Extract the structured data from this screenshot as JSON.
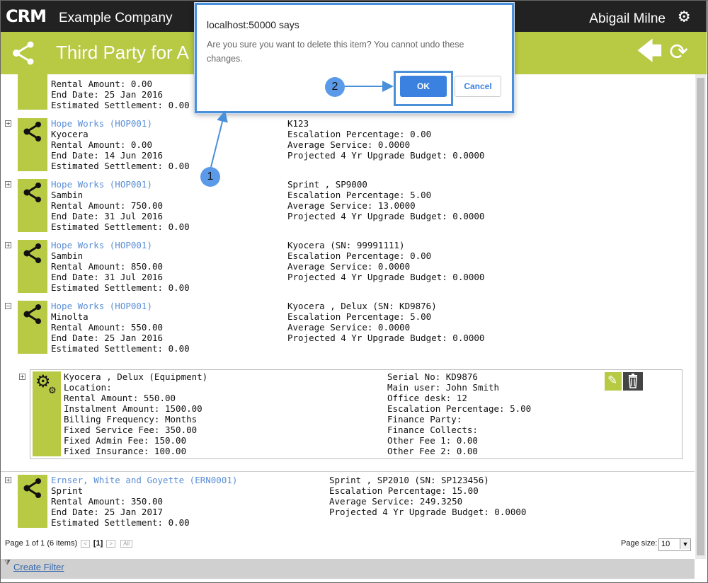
{
  "header": {
    "logo": "CRM",
    "company": "Example Company",
    "user": "Abigail Milne"
  },
  "titlebar": {
    "title": "Third Party for A"
  },
  "top_partial": {
    "lines": [
      "Rental Amount: 0.00",
      "End Date: 25 Jan 2016",
      "Estimated Settlement: 0.00"
    ]
  },
  "records": [
    {
      "name": "Hope Works (HOP001)",
      "left": [
        "Kyocera",
        "Rental Amount: 0.00",
        "End Date: 14 Jun 2016",
        "Estimated Settlement: 0.00"
      ],
      "right": [
        "K123",
        "Escalation Percentage: 0.00",
        "Average Service: 0.0000",
        "Projected 4 Yr Upgrade Budget: 0.0000"
      ],
      "expander": "+"
    },
    {
      "name": "Hope Works (HOP001)",
      "left": [
        "Sambin",
        "Rental Amount: 750.00",
        "End Date: 31 Jul 2016",
        "Estimated Settlement: 0.00"
      ],
      "right": [
        "Sprint , SP9000",
        "Escalation Percentage: 5.00",
        "Average Service: 13.0000",
        "Projected 4 Yr Upgrade Budget: 0.0000"
      ],
      "expander": "+"
    },
    {
      "name": "Hope Works (HOP001)",
      "left": [
        "Sambin",
        "Rental Amount: 850.00",
        "End Date: 31 Jul 2016",
        "Estimated Settlement: 0.00"
      ],
      "right": [
        "Kyocera (SN: 99991111)",
        "Escalation Percentage: 0.00",
        "Average Service: 0.0000",
        "Projected 4 Yr Upgrade Budget: 0.0000"
      ],
      "expander": "+"
    },
    {
      "name": "Hope Works (HOP001)",
      "left": [
        "Minolta",
        "Rental Amount: 550.00",
        "End Date: 25 Jan 2016",
        "Estimated Settlement: 0.00"
      ],
      "right": [
        "Kyocera , Delux (SN: KD9876)",
        "Escalation Percentage: 5.00",
        "Average Service: 0.0000",
        "Projected 4 Yr Upgrade Budget: 0.0000"
      ],
      "expander": "−"
    }
  ],
  "detail": {
    "expander": "+",
    "left": [
      "Kyocera , Delux (Equipment)",
      "Location:",
      "Rental Amount: 550.00",
      "Instalment Amount: 1500.00",
      "Billing Frequency: Months",
      "Fixed Service Fee: 350.00",
      "Fixed Admin Fee: 150.00",
      "Fixed Insurance: 100.00"
    ],
    "right": [
      "Serial No: KD9876",
      "Main user: John Smith",
      "Office desk: 12",
      "Escalation Percentage: 5.00",
      "Finance Party:",
      "Finance Collects:",
      "Other Fee 1: 0.00",
      "Other Fee 2: 0.00"
    ]
  },
  "last_record": {
    "name": "Ernser, White and Goyette (ERN0001)",
    "left": [
      "Sprint",
      "Rental Amount: 350.00",
      "End Date: 25 Jan 2017",
      "Estimated Settlement: 0.00"
    ],
    "right": [
      "Sprint , SP2010 (SN: SP123456)",
      "Escalation Percentage: 15.00",
      "Average Service: 249.3250",
      "Projected 4 Yr Upgrade Budget: 0.0000"
    ],
    "expander": "+"
  },
  "pager": {
    "summary": "Page 1 of 1 (6 items)",
    "prev": "<",
    "current": "[1]",
    "next": ">",
    "all": "All",
    "page_size_label": "Page size:",
    "page_size_value": "10"
  },
  "filter": {
    "label": "Create Filter"
  },
  "dialog": {
    "title": "localhost:50000 says",
    "message": "Are you sure you want to delete this item? You cannot undo these changes.",
    "ok": "OK",
    "cancel": "Cancel"
  },
  "markers": [
    "1",
    "2"
  ],
  "colors": {
    "accent": "#b8c944",
    "dialog_border": "#4a90d9",
    "ok_button": "#3b82e0",
    "link": "#5b8fd6",
    "topbar": "#222222"
  }
}
